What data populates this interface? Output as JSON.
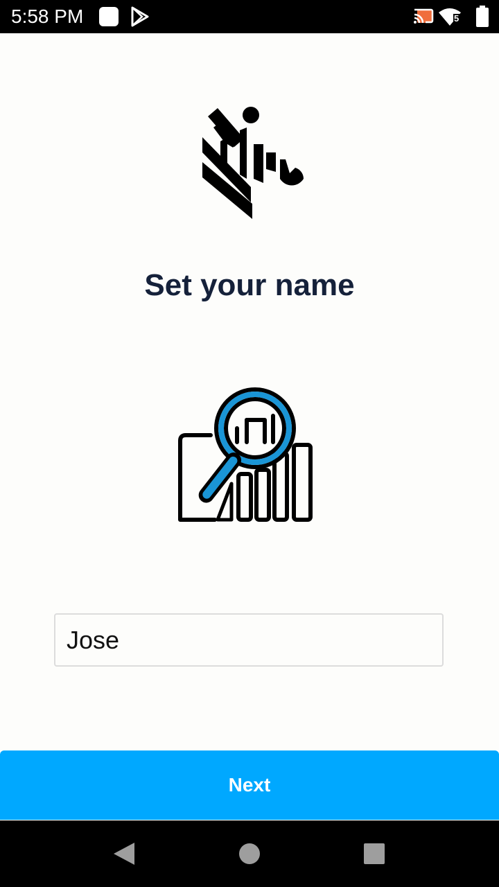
{
  "status_bar": {
    "time": "5:58 PM",
    "icons": [
      "notification-square-icon",
      "play-store-icon",
      "cast-icon",
      "wifi-icon",
      "battery-icon"
    ],
    "wifi_badge": "5"
  },
  "main": {
    "logo_icon": "zebra-logo-icon",
    "title": "Set your name",
    "illustration_icon": "inventory-search-icon",
    "name_input": {
      "value": "Jose",
      "placeholder": ""
    },
    "next_label": "Next"
  },
  "nav_bar": {
    "icons": [
      "back-icon",
      "home-icon",
      "recents-icon"
    ]
  },
  "colors": {
    "accent": "#00a8ff",
    "title": "#15213a",
    "illustration_blue": "#1a95d6",
    "background": "#fdfdfb"
  }
}
